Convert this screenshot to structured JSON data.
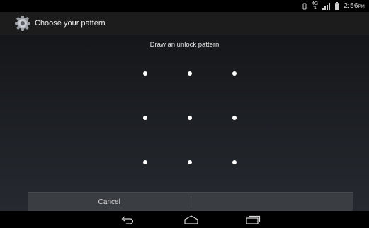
{
  "status_bar": {
    "network": "4G",
    "time": "2:56",
    "time_suffix": "PM",
    "icons": [
      "vibrate-icon",
      "network-4g-icon",
      "signal-icon",
      "battery-icon"
    ]
  },
  "action_bar": {
    "title": "Choose your pattern",
    "icon": "settings-gear-icon"
  },
  "content": {
    "instruction": "Draw an unlock pattern",
    "pattern_dots": 9
  },
  "buttons": {
    "cancel": "Cancel",
    "continue": ""
  },
  "nav_bar": {
    "icons": [
      "back-icon",
      "home-icon",
      "recent-apps-icon"
    ]
  },
  "colors": {
    "action_bar_bg": "#1c1c1c",
    "button_bar_bg": "#3a3d42",
    "dot": "#ffffff"
  }
}
